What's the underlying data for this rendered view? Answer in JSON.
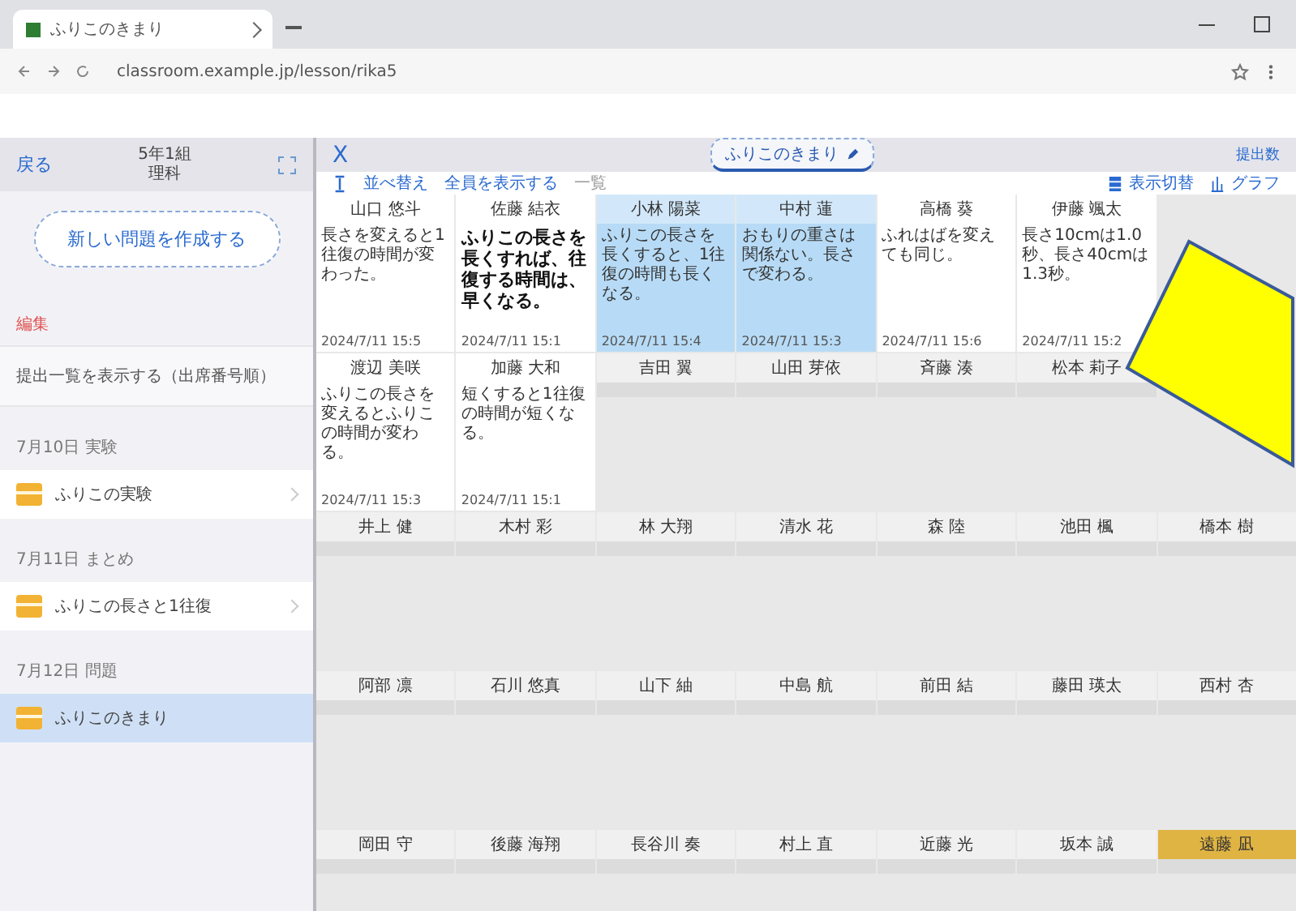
{
  "browser": {
    "tab_title": "ふりこのきまり",
    "url": "classroom.example.jp/lesson/rika5"
  },
  "sidebar": {
    "back": "戻る",
    "class_title": [
      "5年1組",
      "理科"
    ],
    "new_button": "新しい問題を作成する",
    "edit_label": "編集",
    "info_row": "提出一覧を表示する（出席番号順）",
    "sections": [
      {
        "label": "7月10日 実験",
        "items": [
          {
            "label": "ふりこの実験",
            "selected": false
          }
        ]
      },
      {
        "label": "7月11日 まとめ",
        "items": [
          {
            "label": "ふりこの長さと1往復",
            "selected": false
          }
        ]
      },
      {
        "label": "7月12日 問題",
        "items": [
          {
            "label": "ふりこのきまり",
            "selected": true
          }
        ]
      }
    ]
  },
  "main": {
    "close": "X",
    "title": "ふりこのきまり",
    "count": "提出数",
    "toolbar": [
      "並べ替え",
      "全員を表示する",
      "一覧"
    ],
    "view_buttons": [
      "表示切替",
      "グラフ"
    ],
    "cards": [
      {
        "kind": "answer",
        "name": "山口 悠斗",
        "body": "長さを変えると1往復の時間が変わった。",
        "date": "2024/7/11 15:5",
        "selected": false,
        "flagged": false,
        "big": false
      },
      {
        "kind": "answer",
        "name": "佐藤 結衣",
        "body": "ふりこの長さを長くすれば、往復する時間は、早くなる。",
        "date": "2024/7/11 15:1",
        "selected": false,
        "flagged": false,
        "big": true
      },
      {
        "kind": "answer",
        "name": "小林 陽菜",
        "body": "ふりこの長さを長くすると、1往復の時間も長くなる。",
        "date": "2024/7/11 15:4",
        "selected": true,
        "flagged": false,
        "big": false
      },
      {
        "kind": "answer",
        "name": "中村 蓮",
        "body": "おもりの重さは関係ない。長さで変わる。",
        "date": "2024/7/11 15:3",
        "selected": true,
        "flagged": false,
        "big": false
      },
      {
        "kind": "answer",
        "name": "高橋 葵",
        "body": "ふれはばを変えても同じ。",
        "date": "2024/7/11 15:6",
        "selected": false,
        "flagged": false,
        "big": false
      },
      {
        "kind": "answer",
        "name": "伊藤 颯太",
        "body": "長さ10cmは1.0秒、長さ40cmは1.3秒。",
        "date": "2024/7/11 15:2",
        "selected": false,
        "flagged": false,
        "big": false
      },
      {
        "kind": "covered"
      },
      {
        "kind": "answer",
        "name": "渡辺 美咲",
        "body": "ふりこの長さを変えるとふりこの時間が変わる。",
        "date": "2024/7/11 15:3",
        "selected": false,
        "flagged": false,
        "big": false
      },
      {
        "kind": "answer",
        "name": "加藤 大和",
        "body": "短くすると1往復の時間が短くなる。",
        "date": "2024/7/11 15:1",
        "selected": false,
        "flagged": false,
        "big": false
      },
      {
        "kind": "blank",
        "name": "吉田 翼",
        "selected": false,
        "flagged": false
      },
      {
        "kind": "blank",
        "name": "山田 芽依",
        "selected": false,
        "flagged": false
      },
      {
        "kind": "blank",
        "name": "斉藤 湊",
        "selected": false,
        "flagged": false
      },
      {
        "kind": "blank",
        "name": "松本 莉子",
        "selected": false,
        "flagged": false
      },
      {
        "kind": "covered"
      },
      {
        "kind": "blank",
        "name": "井上 健",
        "selected": false,
        "flagged": false
      },
      {
        "kind": "blank",
        "name": "木村 彩",
        "selected": false,
        "flagged": false
      },
      {
        "kind": "blank",
        "name": "林 大翔",
        "selected": false,
        "flagged": false
      },
      {
        "kind": "blank",
        "name": "清水 花",
        "selected": false,
        "flagged": false
      },
      {
        "kind": "blank",
        "name": "森 陸",
        "selected": false,
        "flagged": false
      },
      {
        "kind": "blank",
        "name": "池田 楓",
        "selected": false,
        "flagged": false
      },
      {
        "kind": "blank",
        "name": "橋本 樹",
        "selected": false,
        "flagged": false
      },
      {
        "kind": "blank",
        "name": "阿部 凛",
        "selected": false,
        "flagged": false
      },
      {
        "kind": "blank",
        "name": "石川 悠真",
        "selected": false,
        "flagged": false
      },
      {
        "kind": "blank",
        "name": "山下 紬",
        "selected": false,
        "flagged": false
      },
      {
        "kind": "blank",
        "name": "中島 航",
        "selected": false,
        "flagged": false
      },
      {
        "kind": "blank",
        "name": "前田 結",
        "selected": false,
        "flagged": false
      },
      {
        "kind": "blank",
        "name": "藤田 瑛太",
        "selected": false,
        "flagged": false
      },
      {
        "kind": "blank",
        "name": "西村 杏",
        "selected": false,
        "flagged": false
      },
      {
        "kind": "blank",
        "name": "岡田 守",
        "selected": false,
        "flagged": false
      },
      {
        "kind": "blank",
        "name": "後藤 海翔",
        "selected": false,
        "flagged": false
      },
      {
        "kind": "blank",
        "name": "長谷川 奏",
        "selected": false,
        "flagged": false
      },
      {
        "kind": "blank",
        "name": "村上 直",
        "selected": false,
        "flagged": false
      },
      {
        "kind": "blank",
        "name": "近藤 光",
        "selected": false,
        "flagged": false
      },
      {
        "kind": "blank",
        "name": "坂本 誠",
        "selected": false,
        "flagged": false
      },
      {
        "kind": "blank",
        "name": "遠藤 凪",
        "selected": false,
        "flagged": true
      }
    ]
  },
  "overlay": {
    "kind": "sticky-note"
  }
}
